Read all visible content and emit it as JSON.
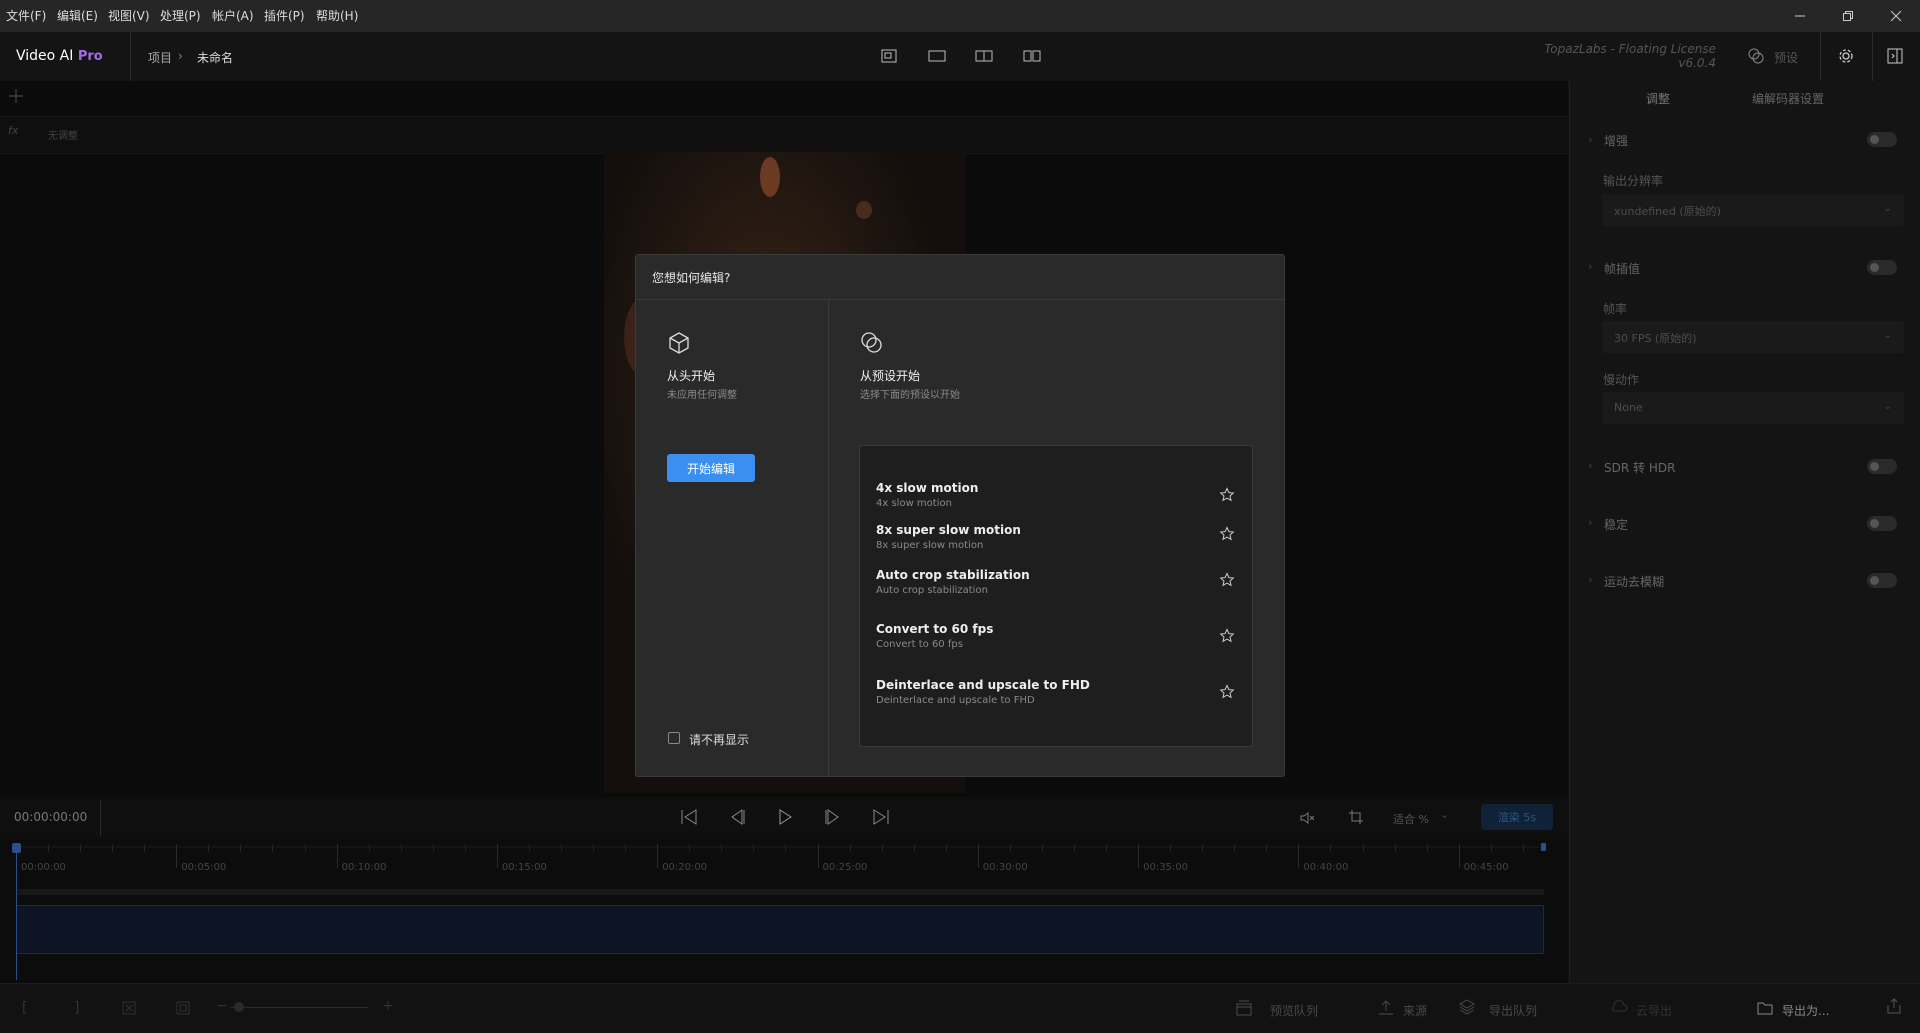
{
  "menu": [
    "文件(F)",
    "编辑(E)",
    "视图(V)",
    "处理(P)",
    "帐户(A)",
    "插件(P)",
    "帮助(H)"
  ],
  "app": {
    "name": "Video AI",
    "edition": "Pro"
  },
  "breadcrumb": {
    "root": "项目",
    "current": "未命名"
  },
  "license": {
    "text": "TopazLabs - Floating License",
    "version": "v6.0.4"
  },
  "header": {
    "presets_label": "预设"
  },
  "fx": {
    "label": "无调整"
  },
  "right_panel": {
    "tabs": [
      "调整",
      "编解码器设置"
    ],
    "sections": {
      "enhance": "增强",
      "output_res_label": "输出分辨率",
      "output_res_value": "xundefined (原始的)",
      "frame_interp": "帧插值",
      "fps_label": "帧率",
      "fps_value": "30 FPS (原始的)",
      "slowmo_label": "慢动作",
      "slowmo_value": "None",
      "sdr_hdr": "SDR 转 HDR",
      "stabilize": "稳定",
      "motion_deblur": "运动去模糊"
    }
  },
  "transport": {
    "timecode": "00:00:00:00",
    "fit_label": "适合 %",
    "render_label": "渲染 5s"
  },
  "timeline": {
    "ticks": [
      "00:00:00",
      "00:05:00",
      "00:10:00",
      "00:15:00",
      "00:20:00",
      "00:25:00",
      "00:30:00",
      "00:35:00",
      "00:40:00",
      "00:45:00"
    ]
  },
  "bottom": {
    "preview_queue": "预览队列",
    "source": "来源",
    "export_queue": "导出队列",
    "cloud_export": "云导出",
    "export_as": "导出为..."
  },
  "dialog": {
    "title": "您想如何编辑?",
    "scratch": {
      "title": "从头开始",
      "subtitle": "未应用任何调整",
      "button": "开始编辑"
    },
    "preset": {
      "title": "从预设开始",
      "subtitle": "选择下面的预设以开始"
    },
    "dont_show": "请不再显示",
    "presets": [
      {
        "title": "4x slow motion",
        "subtitle": "4x slow motion"
      },
      {
        "title": "8x super slow motion",
        "subtitle": "8x super slow motion"
      },
      {
        "title": "Auto crop stabilization",
        "subtitle": "Auto crop stabilization"
      },
      {
        "title": "Convert to 60 fps",
        "subtitle": "Convert to 60 fps"
      },
      {
        "title": "Deinterlace and upscale to FHD",
        "subtitle": "Deinterlace and upscale to FHD"
      }
    ]
  },
  "colors": {
    "accent": "#3b8ff0",
    "pro": "#a56be3"
  }
}
